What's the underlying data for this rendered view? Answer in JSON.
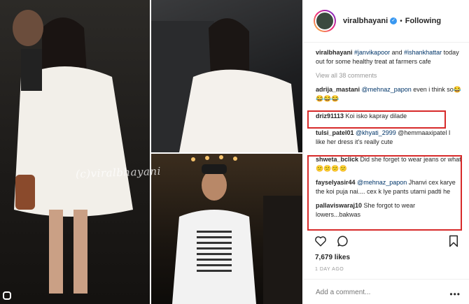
{
  "photo": {
    "watermark": "(c)viralbhayani"
  },
  "header": {
    "username": "viralbhayani",
    "separator": "•",
    "follow_label": "Following"
  },
  "caption": {
    "username": "viralbhayani",
    "tag1": "#janvikapoor",
    "text1": " and ",
    "tag2": "#ishankhattar",
    "text2": " today out for some healthy treat at farmers cafe"
  },
  "view_all": "View all 38 comments",
  "comments": [
    {
      "user": "adrija_mastani",
      "mention": "@mehnaz_papon",
      "text": " even i think so😂😂😂😂"
    },
    {
      "user": "driz91113",
      "mention": "",
      "text": " Koi isko kapray dilade"
    },
    {
      "user": "tulsi_patel01",
      "mention": "@khyati_2999",
      "text": " @hemmaaxipatel I like her dress it's really cute"
    },
    {
      "user": "shweta_bclick",
      "mention": "",
      "text": " Did she forget to wear jeans or what😕😕😕😕"
    },
    {
      "user": "fayselyasir44",
      "mention": "@mehnaz_papon",
      "text": " Jhanvi cex karye the koi puja nai.... cex k lye pants utarni padti he"
    },
    {
      "user": "pallaviswaraj10",
      "mention": "",
      "text": " She forgot to wear lowers...bakwas"
    }
  ],
  "likes": "7,679 likes",
  "timestamp": "1 DAY AGO",
  "add_comment_placeholder": "Add a comment...",
  "more_dots": "•••",
  "colors": {
    "highlight": "#d72a2a",
    "link": "#003569",
    "verified": "#3897f0"
  }
}
